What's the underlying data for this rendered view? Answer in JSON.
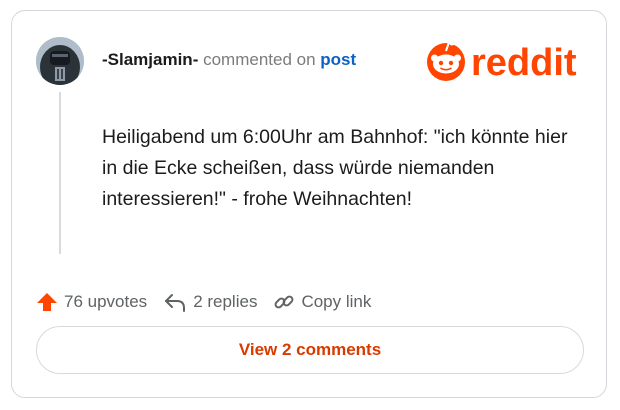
{
  "comment": {
    "username": "-Slamjamin-",
    "commented_on": "commented on",
    "post_link": "post",
    "body": "Heiligabend um 6:00Uhr am Bahnhof: \"ich könnte hier in die Ecke scheißen, dass würde niemanden interessieren!\" - frohe Weihnachten!",
    "avatar_icon": "user-avatar-icon"
  },
  "brand": {
    "logo_text": "reddit",
    "color": "#ff4500"
  },
  "actions": {
    "upvotes_label": "76 upvotes",
    "replies_label": "2 replies",
    "copy_link_label": "Copy link",
    "upvote_icon": "upvote-arrow-icon",
    "reply_icon": "reply-arrow-icon",
    "link_icon": "link-icon",
    "upvote_color": "#ff4500"
  },
  "view_comments_button": {
    "label": "View 2 comments",
    "color": "#d93a00"
  }
}
